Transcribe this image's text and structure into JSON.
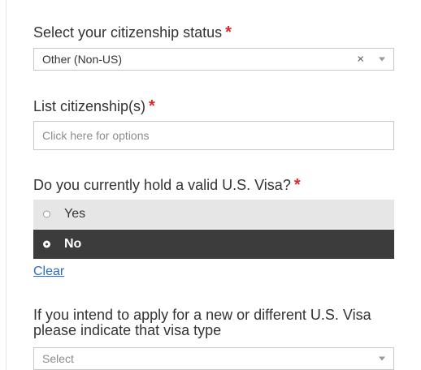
{
  "citizenship_status": {
    "label": "Select your citizenship status",
    "required_mark": "*",
    "value": "Other (Non-US)",
    "clear_symbol": "×"
  },
  "citizenships": {
    "label": "List citizenship(s)",
    "required_mark": "*",
    "placeholder": "Click here for options"
  },
  "visa_question": {
    "label": "Do you currently hold a valid U.S. Visa?",
    "required_mark": "*",
    "options": [
      {
        "label": "Yes",
        "selected": false
      },
      {
        "label": "No",
        "selected": true
      }
    ],
    "clear_label": "Clear"
  },
  "visa_type": {
    "label_line1": "If you intend to apply for a new or different U.S. Visa",
    "label_line2": "please indicate that visa type",
    "placeholder": "Select"
  },
  "colors": {
    "required": "#e0262b",
    "selected_option_bg": "#3c3c3c",
    "unselected_option_bg": "#e6e6e6",
    "link": "#2b6cc4"
  },
  "icons": {
    "clear": "close-icon",
    "dropdown": "chevron-down-icon",
    "radio": "radio-button-icon"
  }
}
